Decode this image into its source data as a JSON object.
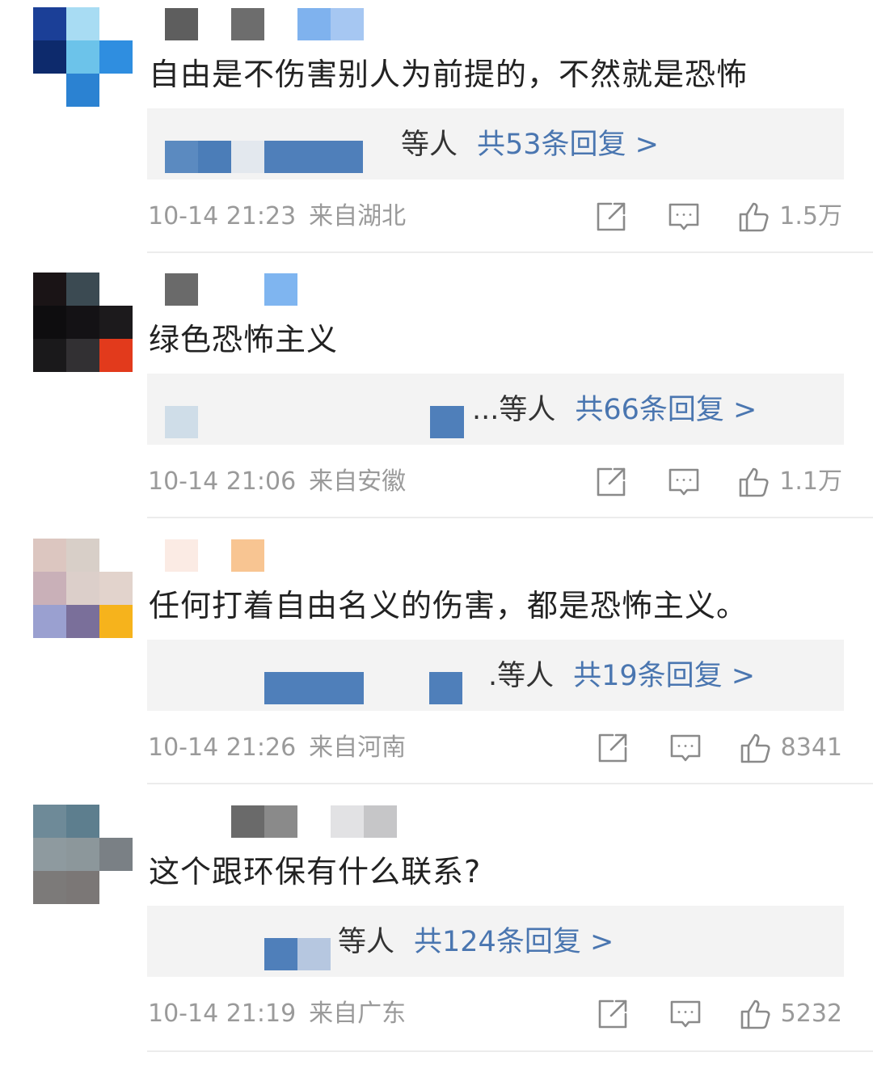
{
  "comments": [
    {
      "text": "自由是不伤害别人为前提的，不然就是恐怖",
      "reply_who": "等人",
      "reply_count": "共53条回复 >",
      "time": "10-14 21:23",
      "region": "来自湖北",
      "likes": "1.5万"
    },
    {
      "text": "绿色恐怖主义",
      "reply_who": "...等人",
      "reply_count": "共66条回复 >",
      "time": "10-14 21:06",
      "region": "来自安徽",
      "likes": "1.1万"
    },
    {
      "text": "任何打着自由名义的伤害，都是恐怖主义。",
      "reply_who": ".等人",
      "reply_count": "共19条回复 >",
      "time": "10-14 21:26",
      "region": "来自河南",
      "likes": "8341"
    },
    {
      "text": "这个跟环保有什么联系?",
      "reply_who": "等人",
      "reply_count": "共124条回复 >",
      "time": "10-14 21:19",
      "region": "来自广东",
      "likes": "5232"
    }
  ],
  "icons": {
    "share": "share-icon",
    "comment": "comment-icon",
    "like": "thumbs-up-icon"
  },
  "colors": {
    "link": "#4a76b0",
    "meta": "#9a9a9a",
    "text": "#222222",
    "reply_bg": "#f3f3f3"
  }
}
